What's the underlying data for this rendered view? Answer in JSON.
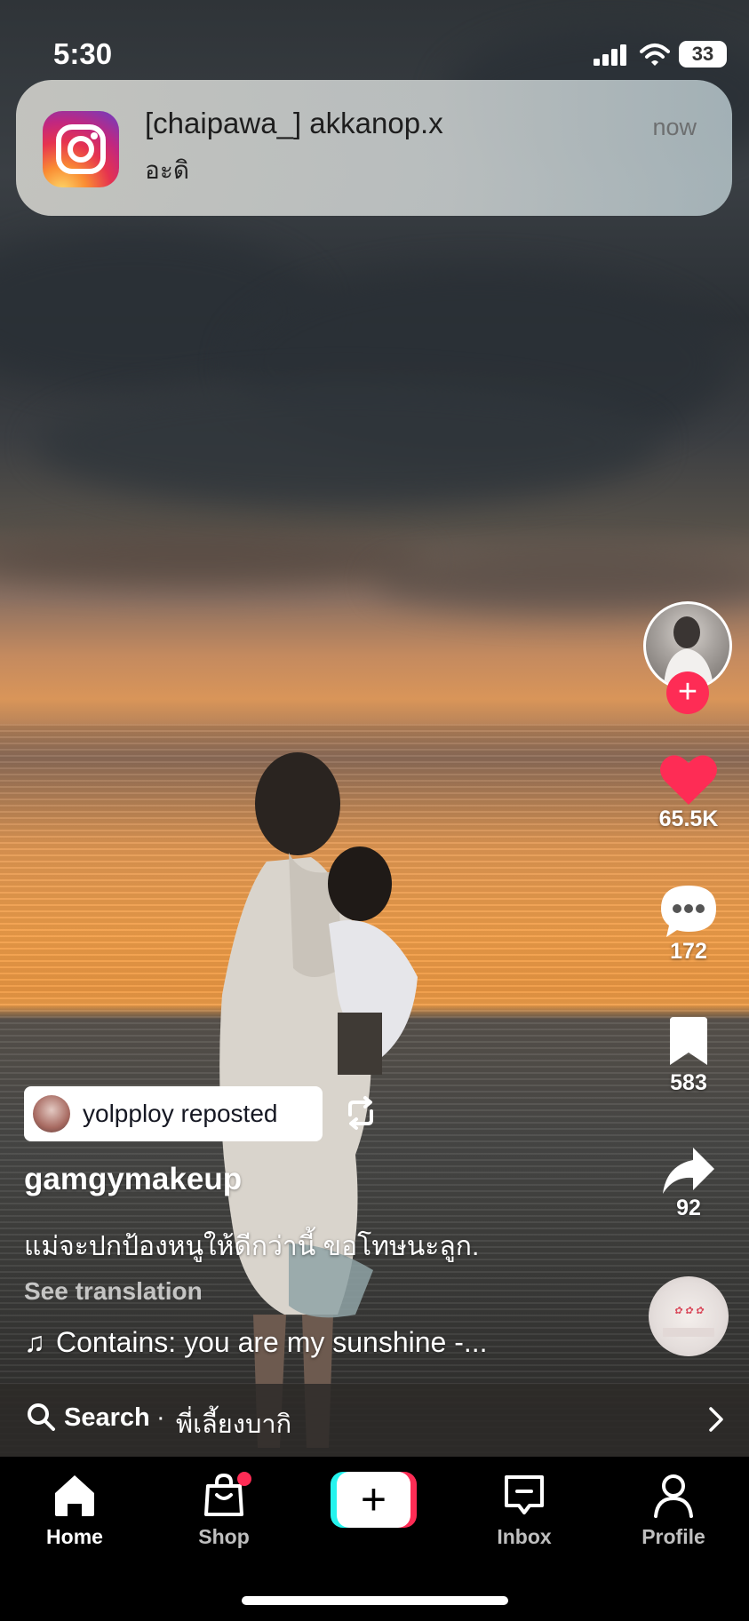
{
  "status_bar": {
    "time": "5:30",
    "battery": "33"
  },
  "notification": {
    "app_icon": "instagram-icon",
    "title": "[chaipawa_] akkanop.x",
    "body": "อะดิ",
    "time": "now"
  },
  "actions": {
    "likes": "65.5K",
    "comments": "172",
    "saves": "583",
    "shares": "92",
    "follow_symbol": "+"
  },
  "post": {
    "repost_label": "yolpploy reposted",
    "author": "gamgymakeup",
    "caption": "แม่จะปกป้องหนูให้ดีกว่านี้ ขอโทษนะลูก.",
    "see_translation": "See translation",
    "music": "Contains: you are my sunshine -..."
  },
  "search": {
    "label": "Search",
    "separator": "·",
    "query": "พี่เลี้ยงบากิ"
  },
  "nav": {
    "home": "Home",
    "shop": "Shop",
    "create": "+",
    "inbox": "Inbox",
    "profile": "Profile"
  },
  "colors": {
    "accent": "#fe2c55",
    "cyan": "#25f4ee"
  }
}
